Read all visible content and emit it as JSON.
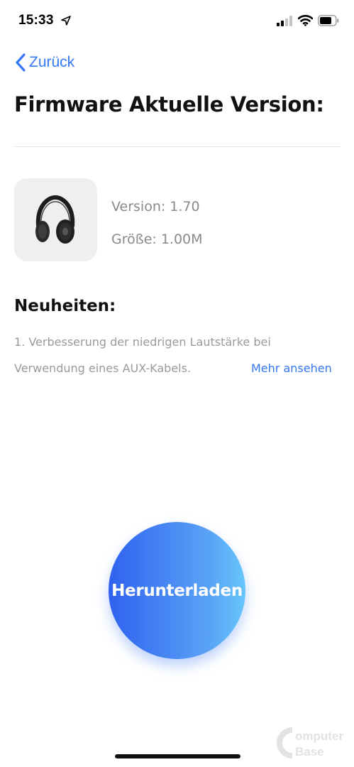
{
  "status_bar": {
    "time": "15:33",
    "location_icon": "location-arrow-icon",
    "signal_icon": "cellular-signal-icon",
    "wifi_icon": "wifi-icon",
    "battery_icon": "battery-icon"
  },
  "nav": {
    "back_label": "Zurück",
    "back_icon": "chevron-left-icon"
  },
  "page": {
    "title": "Firmware Aktuelle Version:"
  },
  "firmware": {
    "image_icon": "headphones-icon",
    "version": "Version: 1.70",
    "size": "Größe: 1.00M"
  },
  "release_notes": {
    "heading": "Neuheiten:",
    "line1": "1. Verbesserung der niedrigen Lautstärke bei",
    "line2": "Verwendung eines AUX-Kabels.",
    "more_link": "Mehr ansehen"
  },
  "actions": {
    "download_label": "Herunterladen"
  },
  "watermark": {
    "text": "ComputerBase"
  },
  "colors": {
    "accent": "#3478f6",
    "gradient_start": "#2f62f0",
    "gradient_end": "#67c6fa",
    "muted_text": "#8a8a8a",
    "card_background": "#efefef"
  }
}
